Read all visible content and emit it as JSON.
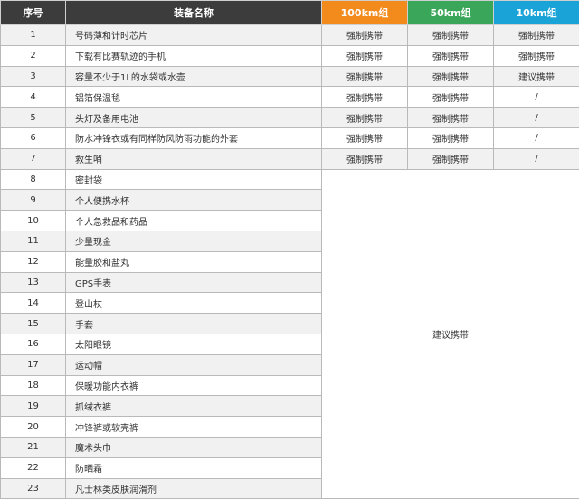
{
  "headers": {
    "no": "序号",
    "name": "装备名称",
    "g100": "100km组",
    "g50": "50km组",
    "g10": "10km组"
  },
  "colors": {
    "header_dark": "#3c3c3c",
    "g100": "#f28a1c",
    "g50": "#3aa65a",
    "g10": "#1aa3d6"
  },
  "rows": [
    {
      "no": "1",
      "name": "号码薄和计时芯片",
      "g100": "强制携带",
      "g50": "强制携带",
      "g10": "强制携带"
    },
    {
      "no": "2",
      "name": "下载有比赛轨迹的手机",
      "g100": "强制携带",
      "g50": "强制携带",
      "g10": "强制携带"
    },
    {
      "no": "3",
      "name": "容量不少于1L的水袋或水壶",
      "g100": "强制携带",
      "g50": "强制携带",
      "g10": "建议携带"
    },
    {
      "no": "4",
      "name": "铝箔保温毯",
      "g100": "强制携带",
      "g50": "强制携带",
      "g10": "/"
    },
    {
      "no": "5",
      "name": "头灯及备用电池",
      "g100": "强制携带",
      "g50": "强制携带",
      "g10": "/"
    },
    {
      "no": "6",
      "name": "防水冲锋衣或有同样防风防雨功能的外套",
      "g100": "强制携带",
      "g50": "强制携带",
      "g10": "/"
    },
    {
      "no": "7",
      "name": "救生哨",
      "g100": "强制携带",
      "g50": "强制携带",
      "g10": "/"
    },
    {
      "no": "8",
      "name": "密封袋"
    },
    {
      "no": "9",
      "name": "个人便携水杯"
    },
    {
      "no": "10",
      "name": "个人急救品和药品"
    },
    {
      "no": "11",
      "name": "少量现金"
    },
    {
      "no": "12",
      "name": "能量胶和盐丸"
    },
    {
      "no": "13",
      "name": "GPS手表"
    },
    {
      "no": "14",
      "name": "登山杖"
    },
    {
      "no": "15",
      "name": "手套"
    },
    {
      "no": "16",
      "name": "太阳眼镜"
    },
    {
      "no": "17",
      "name": "运动帽"
    },
    {
      "no": "18",
      "name": "保暖功能内衣裤"
    },
    {
      "no": "19",
      "name": "抓绒衣裤"
    },
    {
      "no": "20",
      "name": "冲锋裤或软壳裤"
    },
    {
      "no": "21",
      "name": "魔术头巾"
    },
    {
      "no": "22",
      "name": "防晒霜"
    },
    {
      "no": "23",
      "name": "凡士林类皮肤润滑剂"
    }
  ],
  "merged_note": "建议携带"
}
